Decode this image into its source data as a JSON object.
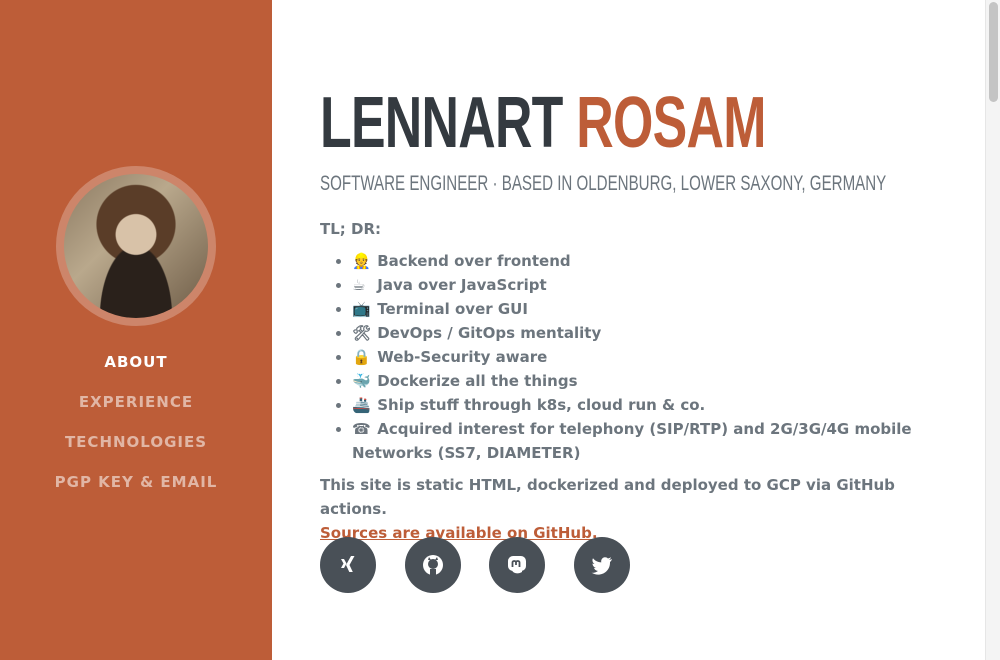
{
  "sidebar": {
    "nav": [
      {
        "label": "ABOUT"
      },
      {
        "label": "EXPERIENCE"
      },
      {
        "label": "TECHNOLOGIES"
      },
      {
        "label": "PGP KEY & EMAIL"
      }
    ]
  },
  "header": {
    "first_name": "LENNART",
    "last_name": "ROSAM",
    "subheading": "SOFTWARE ENGINEER · BASED IN OLDENBURG, LOWER SAXONY, GERMANY"
  },
  "about": {
    "tldr": "TL; DR:",
    "items": [
      {
        "emoji": "👷",
        "text": "Backend over frontend"
      },
      {
        "emoji": "☕",
        "text": "Java over JavaScript"
      },
      {
        "emoji": "📺",
        "text": "Terminal over GUI"
      },
      {
        "emoji": "🛠",
        "text": "DevOps / GitOps mentality"
      },
      {
        "emoji": "🔒",
        "text": "Web-Security aware"
      },
      {
        "emoji": "🐳",
        "text": "Dockerize all the things"
      },
      {
        "emoji": "🚢",
        "text": "Ship stuff through k8s, cloud run & co."
      },
      {
        "emoji": "☎",
        "text": "Acquired interest for telephony (SIP/RTP) and 2G/3G/4G mobile Networks (SS7, DIAMETER)"
      }
    ],
    "static_note": "This site is static HTML, dockerized and deployed to GCP via GitHub actions.",
    "sources_link": "Sources are available on GitHub."
  },
  "social": [
    {
      "icon": "xing-icon"
    },
    {
      "icon": "github-icon"
    },
    {
      "icon": "mastodon-icon"
    },
    {
      "icon": "twitter-icon"
    }
  ],
  "colors": {
    "accent": "#bd5d38",
    "heading": "#343a40",
    "text": "#6c757d",
    "social_bg": "#495057"
  }
}
